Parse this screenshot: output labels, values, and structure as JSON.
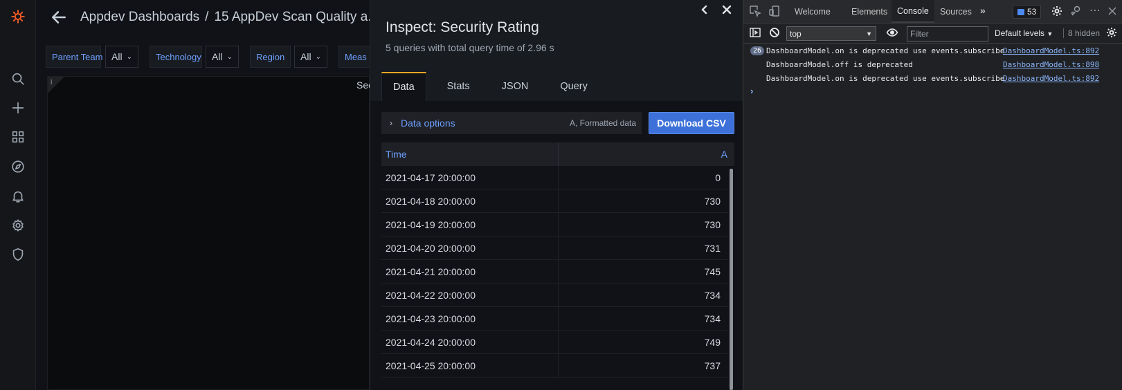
{
  "dashboard": {
    "breadcrumb": {
      "folder": "Appdev Dashboards",
      "separator": "/",
      "title": "15 AppDev Scan Quality a..."
    },
    "variables": [
      {
        "label": "Parent Team",
        "value": "All"
      },
      {
        "label": "Technology",
        "value": "All"
      },
      {
        "label": "Region",
        "value": "All"
      },
      {
        "label": "Meas",
        "value": ""
      }
    ],
    "panel": {
      "info_icon": "i",
      "title": "Sec"
    }
  },
  "inspect": {
    "title": "Inspect: Security Rating",
    "subtitle": "5 queries with total query time of 2.96 s",
    "tabs": [
      {
        "label": "Data",
        "active": true
      },
      {
        "label": "Stats",
        "active": false
      },
      {
        "label": "JSON",
        "active": false
      },
      {
        "label": "Query",
        "active": false
      }
    ],
    "data_options": {
      "label": "Data options",
      "hint": "A, Formatted data"
    },
    "download_label": "Download CSV",
    "table": {
      "columns": [
        "Time",
        "A"
      ],
      "rows": [
        [
          "2021-04-17 20:00:00",
          "0"
        ],
        [
          "2021-04-18 20:00:00",
          "730"
        ],
        [
          "2021-04-19 20:00:00",
          "730"
        ],
        [
          "2021-04-20 20:00:00",
          "731"
        ],
        [
          "2021-04-21 20:00:00",
          "745"
        ],
        [
          "2021-04-22 20:00:00",
          "734"
        ],
        [
          "2021-04-23 20:00:00",
          "734"
        ],
        [
          "2021-04-24 20:00:00",
          "749"
        ],
        [
          "2021-04-25 20:00:00",
          "737"
        ]
      ]
    }
  },
  "devtools": {
    "tabs": [
      "Welcome",
      "Elements",
      "Console",
      "Sources"
    ],
    "active_tab": "Console",
    "more_tabs": "»",
    "message_count": "53",
    "context": "top",
    "filter_placeholder": "Filter",
    "levels": "Default levels",
    "hidden": "8 hidden",
    "messages": [
      {
        "count": "26",
        "text": "DashboardModel.on is deprecated use events.subscribe",
        "source": "DashboardModel.ts:892"
      },
      {
        "count": "",
        "text": "DashboardModel.off is deprecated",
        "source": "DashboardModel.ts:898"
      },
      {
        "count": "",
        "text": "DashboardModel.on is deprecated use events.subscribe",
        "source": "DashboardModel.ts:892"
      }
    ],
    "prompt": "›"
  },
  "colors": {
    "accent_blue": "#6e9fff",
    "button_blue": "#3d71d9",
    "tab_active_border": "#f5a623",
    "grafana_orange": "#f05a28"
  }
}
